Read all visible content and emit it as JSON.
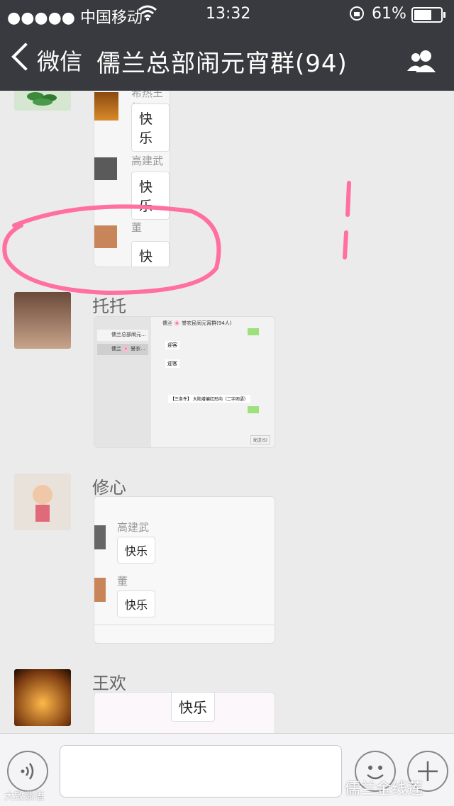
{
  "status_bar": {
    "carrier": "●●●●● 中国移动",
    "time": "13:32",
    "battery": "61%"
  },
  "nav": {
    "back_label": "微信",
    "title": "儒兰总部闹元宵群(94)"
  },
  "messages": {
    "m1": {
      "rows": [
        {
          "name": "希热王红",
          "text": "快乐"
        },
        {
          "name": "高建武",
          "text": "快乐"
        },
        {
          "name": "董",
          "text": "快乐"
        }
      ]
    },
    "m2": {
      "sender": "托托",
      "window_title": "儒兰 🌸 誉农民闹元宵群(94人)",
      "list_item": "儒兰总部闹元...",
      "list_item2": "儒兰 🌸 誉农...",
      "bubble_text": "迎客",
      "quote_text": "【三条件】 大陆增编红形向（二字闹语）",
      "send_label": "发送(S)"
    },
    "m3": {
      "sender": "修心",
      "rows": [
        {
          "name": "高建武",
          "text": "快乐"
        },
        {
          "name": "董",
          "text": "快乐"
        }
      ]
    },
    "m4": {
      "sender": "王欢",
      "text": "快乐"
    }
  },
  "watermarks": {
    "left": "大致翡语",
    "right": "儒兰金线莲"
  },
  "colors": {
    "nav_bg": "#393a3f",
    "chat_bg": "#ebebeb",
    "annotation": "#ff6fa2",
    "wechat_green": "#1aad19"
  }
}
